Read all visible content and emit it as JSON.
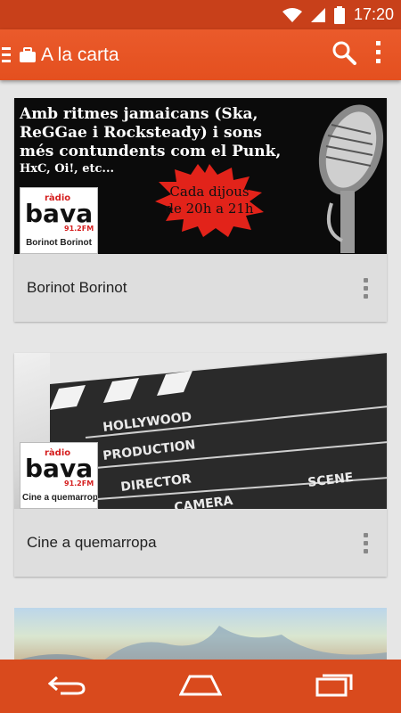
{
  "status_bar": {
    "time": "17:20",
    "icons": [
      "wifi-icon",
      "signal-icon",
      "battery-icon"
    ]
  },
  "app_bar": {
    "title": "A la carta",
    "icons": [
      "drawer-icon",
      "briefcase-icon",
      "search-icon",
      "overflow-menu-icon"
    ]
  },
  "cards": [
    {
      "title": "Borinot Borinot",
      "logo": {
        "brand": "ràdio",
        "name": "bava",
        "freq": "91.2FM",
        "caption": "Borinot Borinot"
      },
      "banner": {
        "line1": "Amb ritmes jamaicans (Ska,",
        "line2": "ReGGae i Rocksteady) i sons",
        "line3": "més contundents com el Punk,",
        "line4": "HxC, Oi!, etc...",
        "burst_line1": "Cada dijous",
        "burst_line2": "de 20h a 21h"
      }
    },
    {
      "title": "Cine a quemarropa",
      "logo": {
        "brand": "ràdio",
        "name": "bava",
        "freq": "91.2FM",
        "caption": "Cine a quemarropa"
      },
      "banner": {
        "slate_words": [
          "HOLLYWOOD",
          "PRODUCTION",
          "DIRECTOR",
          "CAMERA",
          "SCENE"
        ]
      }
    }
  ],
  "nav_bar": {
    "icons": [
      "back-icon",
      "home-icon",
      "recents-icon"
    ]
  },
  "colors": {
    "status_bar": "#c8401a",
    "app_bar": "#e4501f",
    "nav_bar": "#d94a1d",
    "background": "#e6e6e6"
  }
}
